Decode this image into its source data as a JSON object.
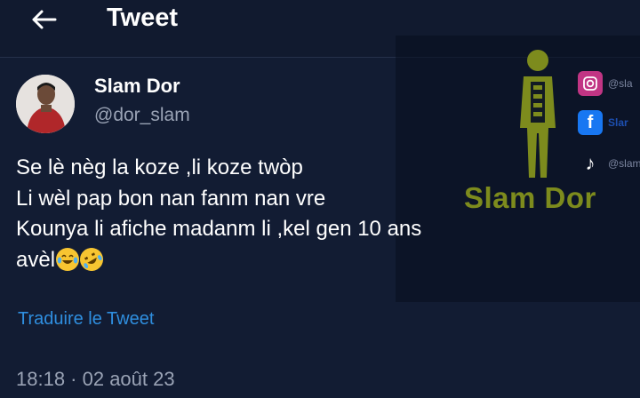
{
  "header": {
    "title": "Tweet",
    "back_icon": "arrow-left-icon"
  },
  "tweet": {
    "author_name": "Slam Dor",
    "author_handle": "@dor_slam",
    "lines": [
      "Se lè nèg la koze ,li koze twòp",
      "Li wèl pap bon nan fanm nan vre",
      "Kounya li afiche madanm li ,kel gen 10 ans",
      "avèl"
    ],
    "emojis": [
      "face-with-tears-of-joy",
      "rolling-on-the-floor-laughing"
    ],
    "translate_label": "Traduire le Tweet",
    "timestamp": "18:18 · 02 août 23"
  },
  "watermark": {
    "text": "Slam Dor",
    "social": [
      {
        "icon": "instagram-icon",
        "label": "@sla"
      },
      {
        "icon": "facebook-icon",
        "label": "Slar"
      },
      {
        "icon": "tiktok-icon",
        "label": "@slam"
      }
    ],
    "color": "#7d8b1d"
  },
  "colors": {
    "background": "#121c33",
    "link": "#2f8fe0",
    "secondary_text": "#9aa3b5"
  }
}
